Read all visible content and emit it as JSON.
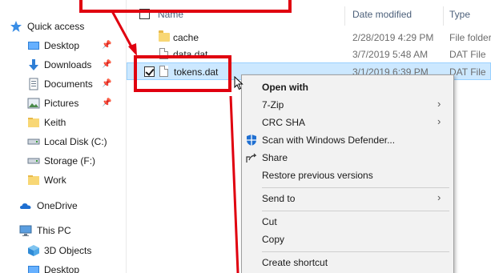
{
  "nav": {
    "quick_access": "Quick access",
    "desktop": "Desktop",
    "downloads": "Downloads",
    "documents": "Documents",
    "pictures": "Pictures",
    "keith": "Keith",
    "local_disk": "Local Disk (C:)",
    "storage": "Storage (F:)",
    "work": "Work",
    "onedrive": "OneDrive",
    "this_pc": "This PC",
    "objects_3d": "3D Objects",
    "desktop2": "Desktop"
  },
  "columns": {
    "name": "Name",
    "date_modified": "Date modified",
    "type": "Type"
  },
  "files": [
    {
      "name": "cache",
      "date": "2/28/2019 4:29 PM",
      "type": "File folder",
      "kind": "folder"
    },
    {
      "name": "data.dat",
      "date": "3/7/2019 5:48 AM",
      "type": "DAT File",
      "kind": "file"
    },
    {
      "name": "tokens.dat",
      "date": "3/1/2019 6:39 PM",
      "type": "DAT File",
      "kind": "file",
      "selected": true
    }
  ],
  "context_menu": {
    "open_with": "Open with",
    "zip": "7-Zip",
    "crc": "CRC SHA",
    "defender": "Scan with Windows Defender...",
    "share": "Share",
    "restore": "Restore previous versions",
    "send_to": "Send to",
    "cut": "Cut",
    "copy": "Copy",
    "create_shortcut": "Create shortcut"
  },
  "colors": {
    "annotation_red": "#e0000f",
    "selection_bg": "#cce8ff",
    "folder": "#f8d775"
  }
}
